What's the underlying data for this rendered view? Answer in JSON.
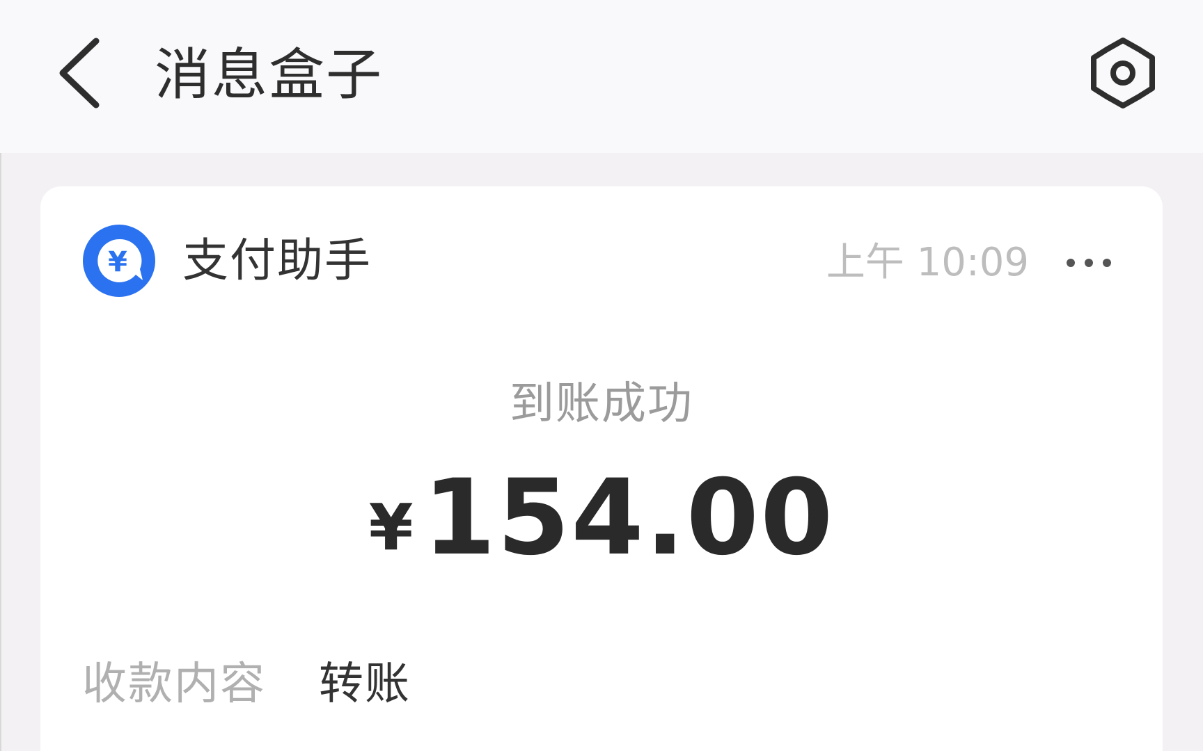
{
  "header": {
    "title": "消息盒子",
    "back_icon": "chevron-left-icon",
    "settings_icon": "gear-icon"
  },
  "message": {
    "sender": "支付助手",
    "avatar_icon": "yuan-chat-bubble-icon",
    "time": "上午 10:09",
    "more_icon": "ellipsis-icon",
    "status": "到账成功",
    "currency_symbol": "¥",
    "amount": "154.00",
    "details": [
      {
        "label": "收款内容",
        "value": "转账"
      }
    ]
  },
  "colors": {
    "accent_blue": "#2a72f0",
    "background": "#f3f1f4",
    "card": "#ffffff",
    "text_dark": "#2e2e2e",
    "text_muted": "#b0b0b0"
  }
}
